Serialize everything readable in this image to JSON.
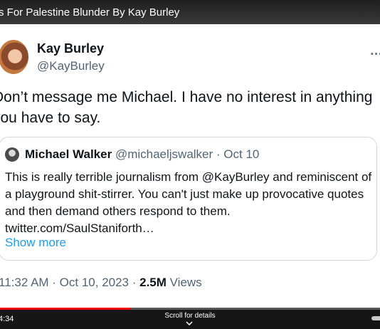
{
  "video": {
    "title": "s For Palestine Blunder By Kay Burley",
    "current_time": "4:34",
    "scroll_hint": "Scroll for details",
    "progress_fraction": 0.345
  },
  "tweet": {
    "author_name": "Kay Burley",
    "author_handle": "@KayBurley",
    "more_icon": "more-horizontal-icon",
    "text": "Don’t message me Michael.  I have no interest in anything you have to say.",
    "quote": {
      "author_name": "Michael Walker",
      "meta": "@michaeljswalker · Oct 10",
      "text": "This is really terrible journalism from @KayBurley and reminiscent of a playground shit-stirrer. You can't just make up provocative quotes and then demand others respond to them. twitter.com/SaulStaniforth…",
      "show_more": "Show more"
    },
    "time": "11:32 AM · Oct 10, 2023 · ",
    "views_count": "2.5M",
    "views_label": " Views"
  },
  "colors": {
    "link": "#1d9bf0",
    "progress": "#ff0000",
    "muted": "#536471"
  }
}
